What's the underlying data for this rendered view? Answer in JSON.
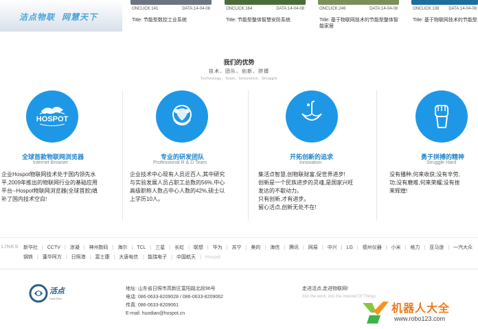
{
  "slogan": {
    "left": "洁点物联",
    "right": "网慧天下"
  },
  "news": [
    {
      "onclick": "ONCLICK:141",
      "data": "DATA:14-04-08",
      "title": "Title: 节能型数控工业系统",
      "thumb_color": "#6b7480"
    },
    {
      "onclick": "ONCLICK:164",
      "data": "DATA:14-04-08",
      "title": "Title: 节能型整体智慧安防系统",
      "thumb_color": "#4c6b3a"
    },
    {
      "onclick": "ONCLICK:246",
      "data": "DATA:14-04-08",
      "title": "Title: 基于物联网技术的节能型整体智能家居",
      "thumb_color": "#7b8f5a"
    },
    {
      "onclick": "ONCLICK:138",
      "data": "DATA:14-04-08",
      "title": "Title: 基于物联网技术的节能型",
      "thumb_color": "#1e6d9c"
    }
  ],
  "advantages": {
    "title": "我们的优势",
    "subtitle": "技术、团队、创新、拼搏",
    "subtitle_en": "Technology、Team、Innovation、Struggle",
    "items": [
      {
        "title": "全球首款物联网浏览器",
        "title_en": "Internet Browser",
        "icon": "hospot-globe-icon",
        "icon_text": "HOSPOT",
        "body": [
          "企业Hospot物联网技术处于国内领先水",
          "平,2009年推出的物联网行业的基础应用",
          "平台--Hospot物联网浏览器(全球首款)填",
          "补了国内技术空白!"
        ]
      },
      {
        "title": "专业的研发团队",
        "title_en": "Professional R & D Team",
        "icon": "team-hands-icon",
        "body": [
          "企业技术中心现有人员近百人,其中研究",
          "与实验发展人员占职工总数的56%,中心",
          "高级职称人数占中心人数的42%,硕士以",
          "上学历10人。"
        ]
      },
      {
        "title": "开拓创新的追求",
        "title_en": "Innovation",
        "icon": "umbrella-icon",
        "body": [
          "集活点智慧,创物联财富,促世界进步!",
          "创新是一个民族进步的灵魂,是国家兴旺",
          "发达的不歇动力。",
          "只有创新,才有进步。",
          "留心活点,创新无处不在!"
        ]
      },
      {
        "title": "勇于拼搏的精神",
        "title_en": "Struggle Hard",
        "icon": "raised-fist-icon",
        "body": [
          "没有播种,何来收获;没有辛劳,",
          "功;没有磨难,何来荣耀;没有挫",
          "来辉煌!"
        ]
      }
    ]
  },
  "links": {
    "label": "LINKS",
    "items": [
      "新华社",
      "CCTV",
      "凉凝",
      "神州数码",
      "海尔",
      "TCL",
      "三星",
      "长虹",
      "联想",
      "华为",
      "苏宁",
      "美的",
      "海信",
      "腾讯",
      "网易",
      "中兴",
      "LG",
      "德州仪器",
      "小米",
      "格力",
      "亚马逊",
      "一汽大众",
      "钢铁",
      "蓬华阿方",
      "日照港",
      "富士康",
      "大唐电信",
      "能瑞电子",
      "中国航天",
      "Hospot"
    ]
  },
  "footer": {
    "brand": "活点",
    "brand_en": "Hoot Dian",
    "address": "地址: 山东省日照市高新区富阳路北段96号",
    "phone": "电话: 086-0633-8209028 / 086-0633-8209062",
    "fax": "传真: 086-0633-8209061",
    "email": "E-mail: huodian@hospot.cn",
    "motto": "走进活点,走进物联网!",
    "motto_en": "Into the work, into the Internet Of Things"
  },
  "watermark": {
    "text": "机器人大全",
    "url": "www.robo123.com"
  },
  "colors": {
    "accent": "#1e98e6",
    "title_blue": "#1e84cc",
    "watermark_orange": "#ee7a1b"
  }
}
